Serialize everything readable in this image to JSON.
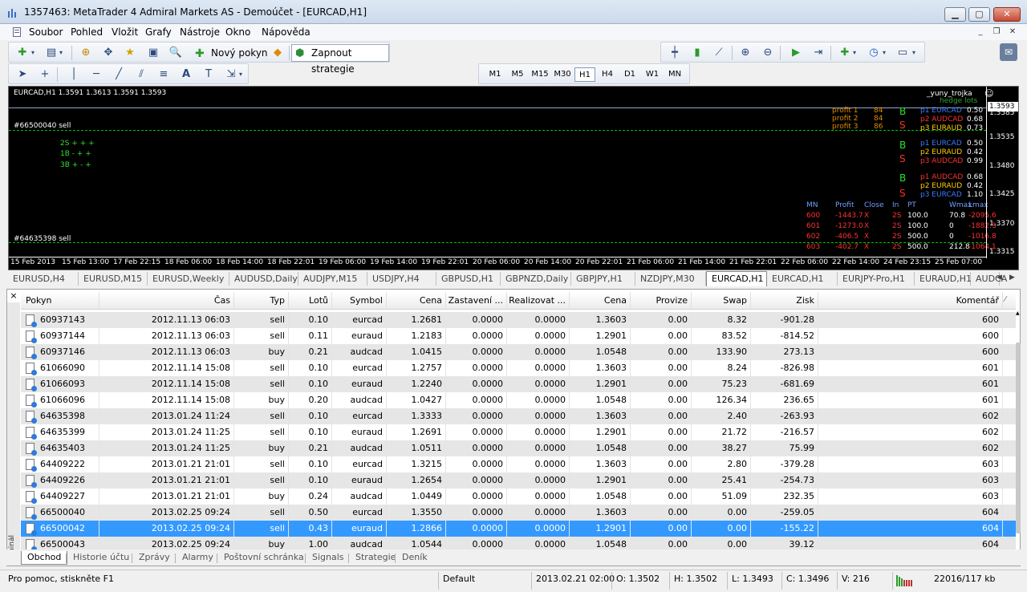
{
  "window": {
    "title": "1357463: MetaTrader 4 Admiral Markets AS - Demoúčet - [EURCAD,H1]"
  },
  "menu": [
    "Soubor",
    "Pohled",
    "Vložit",
    "Grafy",
    "Nástroje",
    "Okno",
    "Nápověda"
  ],
  "toolbar": {
    "new_order": "Nový pokyn",
    "autotrading": "Zapnout strategie"
  },
  "timeframes": [
    "M1",
    "M5",
    "M15",
    "M30",
    "H1",
    "H4",
    "D1",
    "W1",
    "MN"
  ],
  "active_timeframe": "H1",
  "chart": {
    "header": "EURCAD,H1  1.3591 1.3613 1.3591 1.3593",
    "top_right_name": "_yuny_trojka",
    "top_right_sub": "hedge lots",
    "line1_label": "#66500040 sell",
    "line2_label": "#64635398 sell",
    "markers": [
      "2S + + +",
      "1B - + +",
      "3B + - +"
    ],
    "profits": [
      {
        "label": "profit 1",
        "value": "84"
      },
      {
        "label": "profit 2",
        "value": "84"
      },
      {
        "label": "profit 3",
        "value": "86"
      }
    ],
    "blocks": [
      [
        {
          "pair": "p1 EURCAD",
          "val": "0.50",
          "color": "#3a7bff"
        },
        {
          "pair": "p2 AUDCAD",
          "val": "0.68",
          "color": "#ff3030"
        },
        {
          "pair": "p3 EURAUD",
          "val": "0.73",
          "color": "#ffd000"
        }
      ],
      [
        {
          "pair": "p1 EURCAD",
          "val": "0.50",
          "color": "#3a7bff"
        },
        {
          "pair": "p2 EURAUD",
          "val": "0.42",
          "color": "#ffd000"
        },
        {
          "pair": "p3 AUDCAD",
          "val": "0.99",
          "color": "#ff3030"
        }
      ],
      [
        {
          "pair": "p1 AUDCAD",
          "val": "0.68",
          "color": "#ff3030"
        },
        {
          "pair": "p2 EURAUD",
          "val": "0.42",
          "color": "#ffd000"
        },
        {
          "pair": "p3 EURCAD",
          "val": "1.10",
          "color": "#3a7bff"
        }
      ]
    ],
    "bs_letters": [
      "B",
      "S",
      "B",
      "S",
      "B",
      "S"
    ],
    "stats_headers": [
      "MN",
      "Profit",
      "Close",
      "In",
      "PT",
      "Wmax",
      "Lmax"
    ],
    "stats_rows": [
      [
        "600",
        "-1443.7",
        "X",
        "2S",
        "100.0",
        "70.8",
        "-2095.6"
      ],
      [
        "601",
        "-1273.0",
        "X",
        "2S",
        "100.0",
        "0",
        "-1882.3"
      ],
      [
        "602",
        "-406.5",
        "X",
        "2S",
        "500.0",
        "0",
        "-1016.8"
      ],
      [
        "603",
        "-402.7",
        "X",
        "2S",
        "500.0",
        "212.8",
        "-1064.1"
      ]
    ],
    "prices": [
      "1.3593",
      "1.3585",
      "1.3535",
      "1.3480",
      "1.3425",
      "1.3370",
      "1.3315"
    ],
    "dates": [
      "15 Feb 2013",
      "15 Feb 13:00",
      "17 Feb 22:15",
      "18 Feb 06:00",
      "18 Feb 14:00",
      "18 Feb 22:01",
      "19 Feb 06:00",
      "19 Feb 14:00",
      "19 Feb 22:01",
      "20 Feb 06:00",
      "20 Feb 14:00",
      "20 Feb 22:01",
      "21 Feb 06:00",
      "21 Feb 14:00",
      "21 Feb 22:01",
      "22 Feb 06:00",
      "22 Feb 14:00",
      "24 Feb 23:15",
      "25 Feb 07:00"
    ]
  },
  "chart_tabs": [
    "EURUSD,H4",
    "EURUSD,M15",
    "EURUSD,Weekly",
    "AUDUSD,Daily",
    "AUDJPY,M15",
    "USDJPY,H4",
    "GBPUSD,H1",
    "GBPNZD,Daily",
    "GBPJPY,H1",
    "NZDJPY,M30",
    "EURCAD,H1",
    "EURCAD,H1",
    "EURJPY-Pro,H1",
    "EURAUD,H1",
    "AUDCA"
  ],
  "active_chart_tab": 10,
  "table": {
    "headers": [
      "Pokyn",
      "Čas",
      "Typ",
      "Lotů",
      "Symbol",
      "Cena",
      "Zastavení ...",
      "Realizovat ...",
      "Cena",
      "Provize",
      "Swap",
      "Zisk",
      "Komentář"
    ],
    "rows": [
      [
        "60937143",
        "2012.11.13 06:03",
        "sell",
        "0.10",
        "eurcad",
        "1.2681",
        "0.0000",
        "0.0000",
        "1.3603",
        "0.00",
        "8.32",
        "-901.28",
        "600"
      ],
      [
        "60937144",
        "2012.11.13 06:03",
        "sell",
        "0.11",
        "euraud",
        "1.2183",
        "0.0000",
        "0.0000",
        "1.2901",
        "0.00",
        "83.52",
        "-814.52",
        "600"
      ],
      [
        "60937146",
        "2012.11.13 06:03",
        "buy",
        "0.21",
        "audcad",
        "1.0415",
        "0.0000",
        "0.0000",
        "1.0548",
        "0.00",
        "133.90",
        "273.13",
        "600"
      ],
      [
        "61066090",
        "2012.11.14 15:08",
        "sell",
        "0.10",
        "eurcad",
        "1.2757",
        "0.0000",
        "0.0000",
        "1.3603",
        "0.00",
        "8.24",
        "-826.98",
        "601"
      ],
      [
        "61066093",
        "2012.11.14 15:08",
        "sell",
        "0.10",
        "euraud",
        "1.2240",
        "0.0000",
        "0.0000",
        "1.2901",
        "0.00",
        "75.23",
        "-681.69",
        "601"
      ],
      [
        "61066096",
        "2012.11.14 15:08",
        "buy",
        "0.20",
        "audcad",
        "1.0427",
        "0.0000",
        "0.0000",
        "1.0548",
        "0.00",
        "126.34",
        "236.65",
        "601"
      ],
      [
        "64635398",
        "2013.01.24 11:24",
        "sell",
        "0.10",
        "eurcad",
        "1.3333",
        "0.0000",
        "0.0000",
        "1.3603",
        "0.00",
        "2.40",
        "-263.93",
        "602"
      ],
      [
        "64635399",
        "2013.01.24 11:25",
        "sell",
        "0.10",
        "euraud",
        "1.2691",
        "0.0000",
        "0.0000",
        "1.2901",
        "0.00",
        "21.72",
        "-216.57",
        "602"
      ],
      [
        "64635403",
        "2013.01.24 11:25",
        "buy",
        "0.21",
        "audcad",
        "1.0511",
        "0.0000",
        "0.0000",
        "1.0548",
        "0.00",
        "38.27",
        "75.99",
        "602"
      ],
      [
        "64409222",
        "2013.01.21 21:01",
        "sell",
        "0.10",
        "eurcad",
        "1.3215",
        "0.0000",
        "0.0000",
        "1.3603",
        "0.00",
        "2.80",
        "-379.28",
        "603"
      ],
      [
        "64409226",
        "2013.01.21 21:01",
        "sell",
        "0.10",
        "euraud",
        "1.2654",
        "0.0000",
        "0.0000",
        "1.2901",
        "0.00",
        "25.41",
        "-254.73",
        "603"
      ],
      [
        "64409227",
        "2013.01.21 21:01",
        "buy",
        "0.24",
        "audcad",
        "1.0449",
        "0.0000",
        "0.0000",
        "1.0548",
        "0.00",
        "51.09",
        "232.35",
        "603"
      ],
      [
        "66500040",
        "2013.02.25 09:24",
        "sell",
        "0.50",
        "eurcad",
        "1.3550",
        "0.0000",
        "0.0000",
        "1.3603",
        "0.00",
        "0.00",
        "-259.05",
        "604"
      ],
      [
        "66500042",
        "2013.02.25 09:24",
        "sell",
        "0.43",
        "euraud",
        "1.2866",
        "0.0000",
        "0.0000",
        "1.2901",
        "0.00",
        "0.00",
        "-155.22",
        "604"
      ],
      [
        "66500043",
        "2013.02.25 09:24",
        "buy",
        "1.00",
        "audcad",
        "1.0544",
        "0.0000",
        "0.0000",
        "1.0548",
        "0.00",
        "0.00",
        "39.12",
        "604"
      ]
    ],
    "selected_row": 13
  },
  "terminal": {
    "side_label": "Terminál",
    "close": "×"
  },
  "terminal_tabs": [
    "Obchod",
    "Historie účtu",
    "Zprávy",
    "Alarmy",
    "Poštovní schránka",
    "Signals",
    "Strategie",
    "Deník"
  ],
  "status": {
    "help": "Pro pomoc, stiskněte F1",
    "profile": "Default",
    "datetime": "2013.02.21 02:00",
    "open": "O: 1.3502",
    "high": "H: 1.3502",
    "low": "L: 1.3493",
    "close": "C: 1.3496",
    "volume": "V: 216",
    "traffic": "22016/117 kb"
  }
}
